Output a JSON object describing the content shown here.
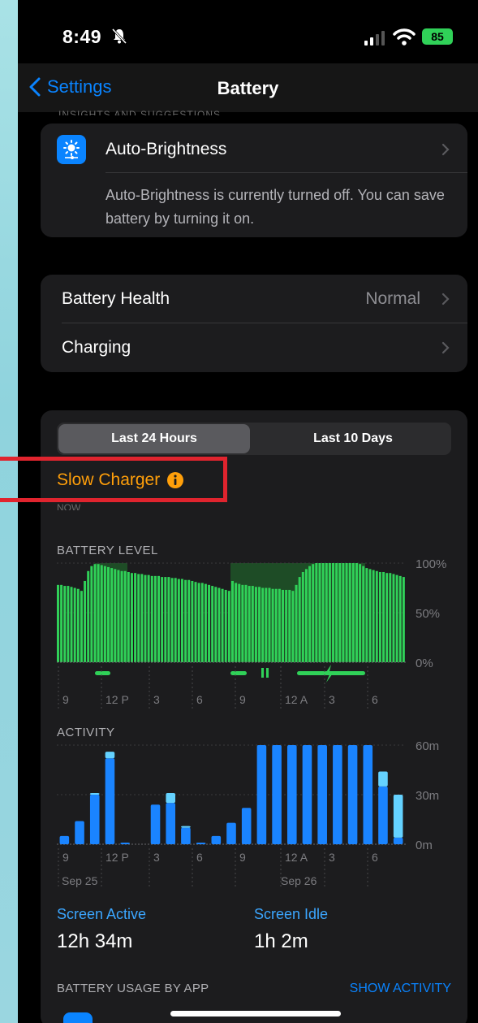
{
  "status_bar": {
    "time": "8:49",
    "battery_percent": "85",
    "icons": [
      "bell-slash-icon",
      "signal-icon",
      "wifi-icon",
      "battery-charging-icon"
    ]
  },
  "nav": {
    "back_label": "Settings",
    "title": "Battery"
  },
  "insights": {
    "title": "Auto-Brightness",
    "description": "Auto-Brightness is currently turned off. You can save battery by turning it on.",
    "icon": "brightness-icon"
  },
  "health": {
    "battery_health_label": "Battery Health",
    "battery_health_value": "Normal",
    "charging_label": "Charging"
  },
  "segmented": {
    "options": [
      "Last 24 Hours",
      "Last 10 Days"
    ],
    "selected": "Last 24 Hours"
  },
  "slow_charger": {
    "label": "Slow Charger"
  },
  "colors": {
    "accent": "#0a84ff",
    "battery_green": "#30d158",
    "warning_orange": "#ff9f0a",
    "activity_blue": "#1a84ff",
    "idle_cyan": "#64d2ff",
    "highlight_red": "#e0242e"
  },
  "battery_chart": {
    "label": "BATTERY LEVEL",
    "y_ticks": [
      "100%",
      "50%",
      "0%"
    ],
    "x_ticks": [
      "9",
      "12 P",
      "3",
      "6",
      "9",
      "12 A",
      "3",
      "6"
    ]
  },
  "activity_chart": {
    "label": "ACTIVITY",
    "y_ticks": [
      "60m",
      "30m",
      "0m"
    ],
    "x_ticks": [
      "9",
      "12 P",
      "3",
      "6",
      "9",
      "12 A",
      "3",
      "6"
    ],
    "date_labels": [
      "Sep 25",
      "Sep 26"
    ]
  },
  "chart_data": [
    {
      "type": "bar",
      "title": "BATTERY LEVEL",
      "ylim": [
        0,
        100
      ],
      "values": [
        78,
        78,
        77,
        77,
        76,
        75,
        74,
        72,
        82,
        92,
        97,
        99,
        99,
        98,
        97,
        96,
        95,
        94,
        93,
        92,
        92,
        91,
        90,
        90,
        89,
        89,
        88,
        88,
        87,
        87,
        87,
        86,
        86,
        86,
        85,
        85,
        84,
        84,
        83,
        83,
        82,
        81,
        80,
        80,
        79,
        78,
        77,
        76,
        75,
        74,
        73,
        72,
        82,
        80,
        79,
        78,
        78,
        77,
        77,
        76,
        76,
        75,
        75,
        75,
        74,
        74,
        74,
        73,
        73,
        73,
        72,
        78,
        86,
        91,
        94,
        97,
        99,
        100,
        100,
        100,
        100,
        100,
        100,
        100,
        100,
        100,
        100,
        100,
        100,
        100,
        99,
        97,
        95,
        94,
        93,
        92,
        91,
        91,
        90,
        90,
        89,
        88,
        87,
        86
      ],
      "charging_hours_note": "",
      "x_ticks": [
        "9",
        "12 P",
        "3",
        "6",
        "9",
        "12 A",
        "3",
        "6"
      ]
    },
    {
      "type": "bar",
      "title": "ACTIVITY",
      "ylim": [
        0,
        60
      ],
      "categories": [
        "9",
        "10",
        "11",
        "12P",
        "1",
        "2",
        "3",
        "4",
        "5",
        "6",
        "7",
        "8",
        "9",
        "10",
        "11",
        "12A",
        "1",
        "2",
        "3",
        "4",
        "5",
        "6",
        "7"
      ],
      "series": [
        {
          "name": "Screen Active",
          "values": [
            5,
            14,
            30,
            52,
            1,
            0,
            24,
            25,
            10,
            1,
            5,
            13,
            22,
            60,
            60,
            60,
            60,
            60,
            60,
            60,
            60,
            35,
            4
          ]
        },
        {
          "name": "Screen Idle",
          "values": [
            0,
            0,
            1,
            4,
            0,
            0,
            0,
            6,
            1,
            0,
            0,
            0,
            0,
            0,
            0,
            0,
            0,
            0,
            0,
            0,
            0,
            9,
            26
          ]
        }
      ],
      "x_ticks": [
        "9",
        "12 P",
        "3",
        "6",
        "9",
        "12 A",
        "3",
        "6"
      ]
    }
  ],
  "stats": {
    "screen_active_label": "Screen Active",
    "screen_active_value": "12h 34m",
    "screen_idle_label": "Screen Idle",
    "screen_idle_value": "1h 2m"
  },
  "usage": {
    "header": "BATTERY USAGE BY APP",
    "show_activity": "SHOW ACTIVITY"
  }
}
